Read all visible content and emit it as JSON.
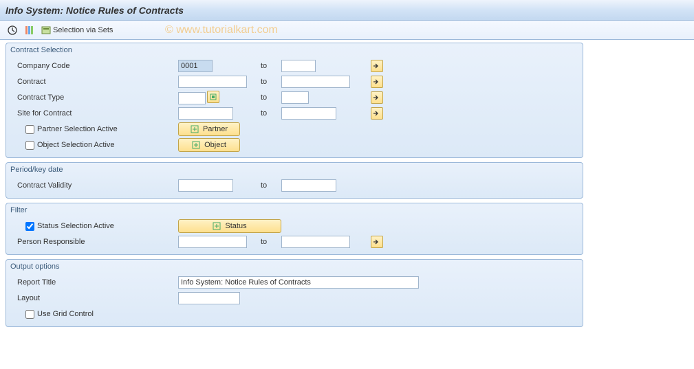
{
  "header": {
    "title": "Info System: Notice Rules of Contracts"
  },
  "toolbar": {
    "selection_via_sets": "Selection via Sets"
  },
  "watermark": "© www.tutorialkart.com",
  "contract_selection": {
    "title": "Contract Selection",
    "company_code": {
      "label": "Company Code",
      "from": "0001",
      "to": ""
    },
    "contract": {
      "label": "Contract",
      "from": "",
      "to": ""
    },
    "contract_type": {
      "label": "Contract Type",
      "from": "",
      "to": ""
    },
    "site": {
      "label": "Site for Contract",
      "from": "",
      "to": ""
    },
    "partner_active": {
      "label": "Partner Selection Active",
      "checked": false,
      "button": "Partner"
    },
    "object_active": {
      "label": "Object Selection Active",
      "checked": false,
      "button": "Object"
    }
  },
  "period": {
    "title": "Period/key date",
    "contract_validity": {
      "label": "Contract Validity",
      "from": "",
      "to": ""
    }
  },
  "filter": {
    "title": "Filter",
    "status_active": {
      "label": "Status Selection Active",
      "checked": true,
      "button": "Status"
    },
    "person_responsible": {
      "label": "Person Responsible",
      "from": "",
      "to": ""
    }
  },
  "output": {
    "title": "Output options",
    "report_title": {
      "label": "Report Title",
      "value": "Info System: Notice Rules of Contracts"
    },
    "layout": {
      "label": "Layout",
      "value": ""
    },
    "use_grid": {
      "label": "Use Grid Control",
      "checked": false
    }
  },
  "common": {
    "to": "to"
  }
}
